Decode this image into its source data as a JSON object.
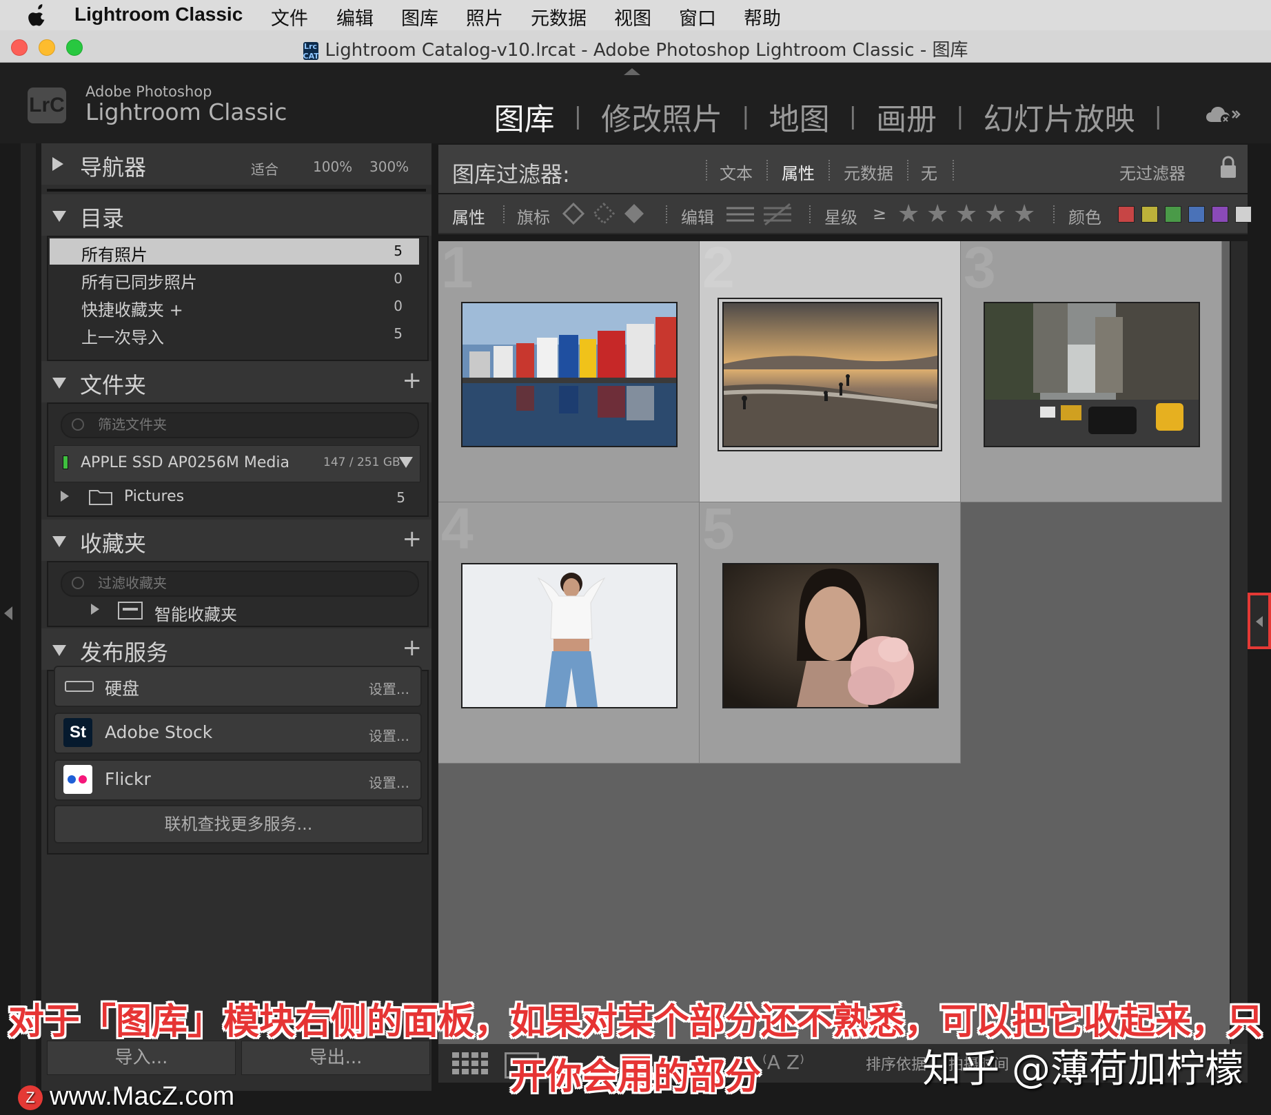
{
  "menubar": {
    "app_name": "Lightroom Classic",
    "items": [
      "文件",
      "编辑",
      "图库",
      "照片",
      "元数据",
      "视图",
      "窗口",
      "帮助"
    ]
  },
  "window": {
    "title": "Lightroom Catalog-v10.lrcat - Adobe Photoshop Lightroom Classic - 图库"
  },
  "brand": {
    "line1": "Adobe Photoshop",
    "line2": "Lightroom Classic",
    "logo": "LrC"
  },
  "modules": [
    "图库",
    "修改照片",
    "地图",
    "画册",
    "幻灯片放映"
  ],
  "active_module": "图库",
  "left_panel": {
    "navigator": {
      "title": "导航器",
      "zoom": [
        "适合",
        "100%",
        "300%"
      ]
    },
    "catalog": {
      "title": "目录",
      "items": [
        {
          "label": "所有照片",
          "count": "5"
        },
        {
          "label": "所有已同步照片",
          "count": "0"
        },
        {
          "label": "快捷收藏夹 +",
          "count": "0"
        },
        {
          "label": "上一次导入",
          "count": "5"
        }
      ]
    },
    "folders": {
      "title": "文件夹",
      "filter_placeholder": "筛选文件夹",
      "volume": {
        "name": "APPLE SSD AP0256M Media",
        "usage": "147 / 251 GB"
      },
      "folder": {
        "name": "Pictures",
        "count": "5"
      }
    },
    "collections": {
      "title": "收藏夹",
      "filter_placeholder": "过滤收藏夹",
      "smart": "智能收藏夹"
    },
    "publish": {
      "title": "发布服务",
      "items": [
        {
          "name": "硬盘",
          "settings": "设置..."
        },
        {
          "name": "Adobe Stock",
          "settings": "设置..."
        },
        {
          "name": "Flickr",
          "settings": "设置..."
        }
      ],
      "find_more": "联机查找更多服务..."
    },
    "import": "导入...",
    "export": "导出..."
  },
  "filter_bar": {
    "label": "图库过滤器:",
    "options": [
      "文本",
      "属性",
      "元数据",
      "无"
    ],
    "active": "属性",
    "preset": "无过滤器"
  },
  "attribute_bar": {
    "label": "属性",
    "flag": "旗标",
    "edit": "编辑",
    "rating": "星级",
    "rating_op": "≥",
    "color": "颜色",
    "colors": [
      "#c74545",
      "#bcb13a",
      "#4a9a48",
      "#4a72b8",
      "#8a4ab8",
      "#d0d0d0"
    ]
  },
  "grid": {
    "cells": [
      {
        "index": "1",
        "subject": "colorful-houses-waterfront",
        "selected": false
      },
      {
        "index": "2",
        "subject": "beach-sunset",
        "selected": true
      },
      {
        "index": "3",
        "subject": "city-street-taxis",
        "selected": false
      },
      {
        "index": "4",
        "subject": "woman-white-shirt",
        "selected": false
      },
      {
        "index": "5",
        "subject": "woman-portrait-pink-ruffle",
        "selected": false
      }
    ]
  },
  "toolbar": {
    "sort_label": "排序依据",
    "sort_value": "拍摄时间"
  },
  "overlay": {
    "subtitle_line1": "对于「图库」模块右侧的面板，如果对某个部分还不熟悉，可以把它收起来，只展",
    "subtitle_line2": "开你会用的部分",
    "zhihu": "知乎 @薄荷加柠檬",
    "watermark": "www.MacZ.com"
  }
}
